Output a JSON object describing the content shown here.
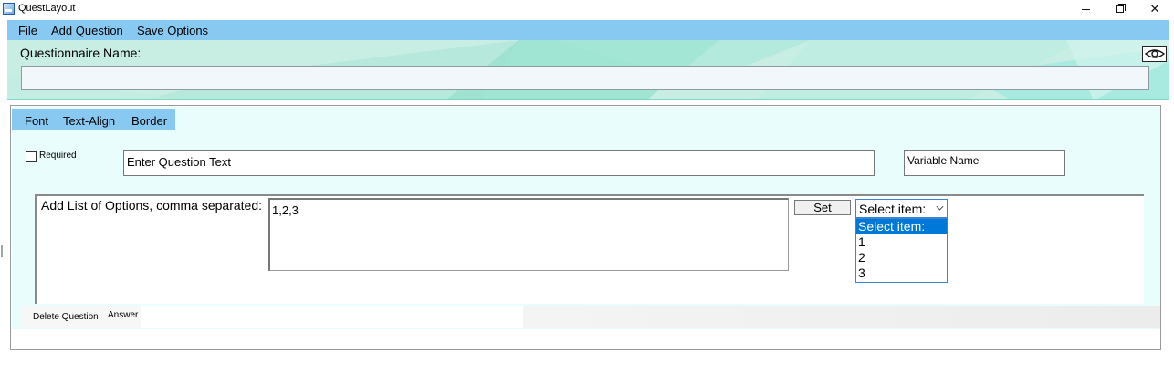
{
  "window": {
    "title": "QuestLayout"
  },
  "menubar": {
    "items": [
      "File",
      "Add Question",
      "Save Options"
    ]
  },
  "questionnaire": {
    "label": "Questionnaire Name:",
    "value": ""
  },
  "question": {
    "tabs": [
      "Font",
      "Text-Align",
      "Border"
    ],
    "required_label": "Required",
    "required_checked": false,
    "question_text": "Enter Question Text",
    "variable_name": "Variable Name",
    "options_label": "Add List of Options, comma separated:",
    "options_value": "1,2,3",
    "set_label": "Set",
    "select": {
      "selected": "Select item:",
      "options": [
        "Select item:",
        "1",
        "2",
        "3"
      ]
    },
    "bottom_tabs": [
      "Delete Question",
      "Answer"
    ]
  },
  "colors": {
    "menubar": "#88c9f2",
    "panel_bg": "#c8eee4",
    "question_bg": "#e8fdfc",
    "selection": "#0078d7"
  },
  "icons": [
    "app-icon",
    "minimize-icon",
    "restore-icon",
    "close-icon",
    "eye-icon",
    "chevron-down-icon"
  ]
}
